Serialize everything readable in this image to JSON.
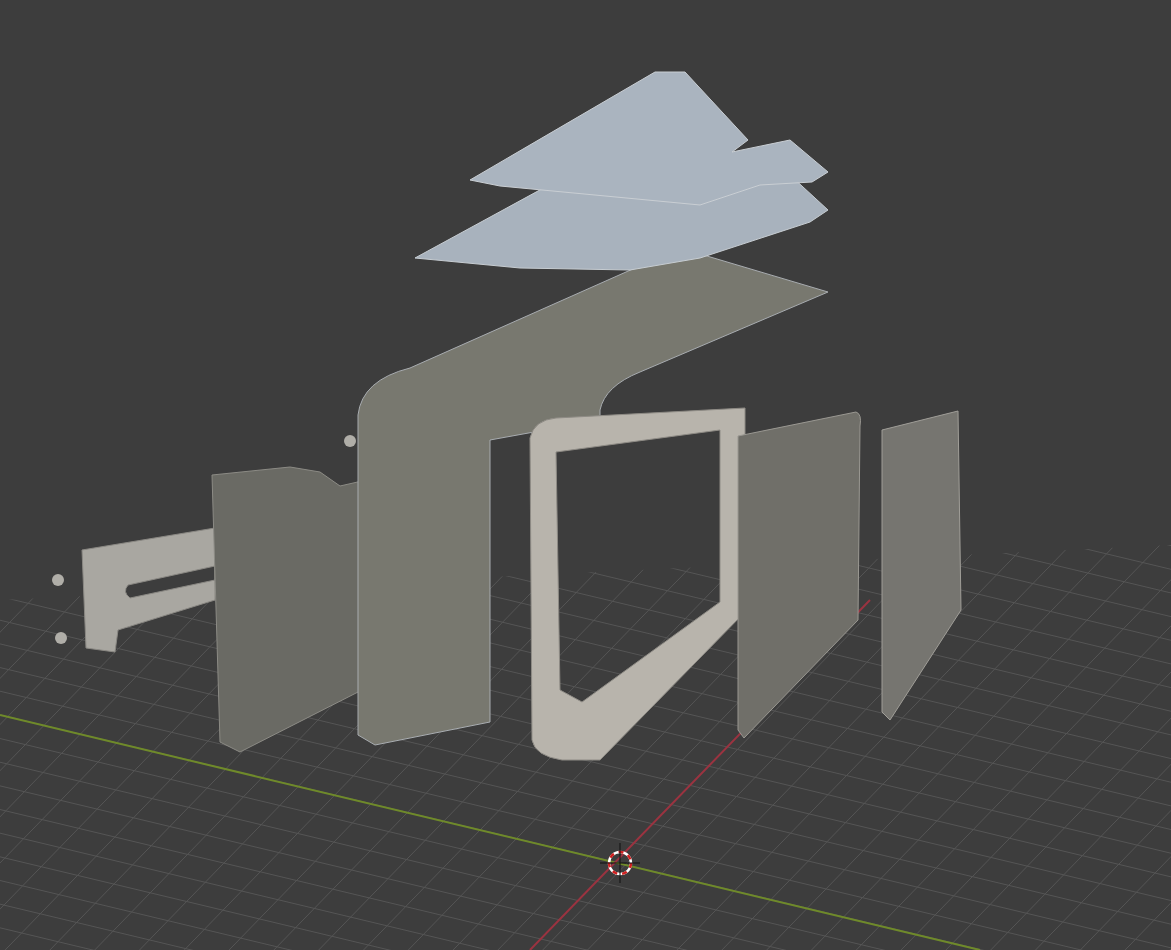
{
  "viewport": {
    "grid": true,
    "axes": true,
    "cursor": true,
    "parts": [
      {
        "kind": "bracket"
      },
      {
        "kind": "side-panel"
      },
      {
        "kind": "cover"
      },
      {
        "kind": "frame"
      },
      {
        "kind": "screen"
      },
      {
        "kind": "back-panel"
      },
      {
        "kind": "middle-plate"
      },
      {
        "kind": "top-plate"
      },
      {
        "kind": "screws"
      }
    ]
  }
}
